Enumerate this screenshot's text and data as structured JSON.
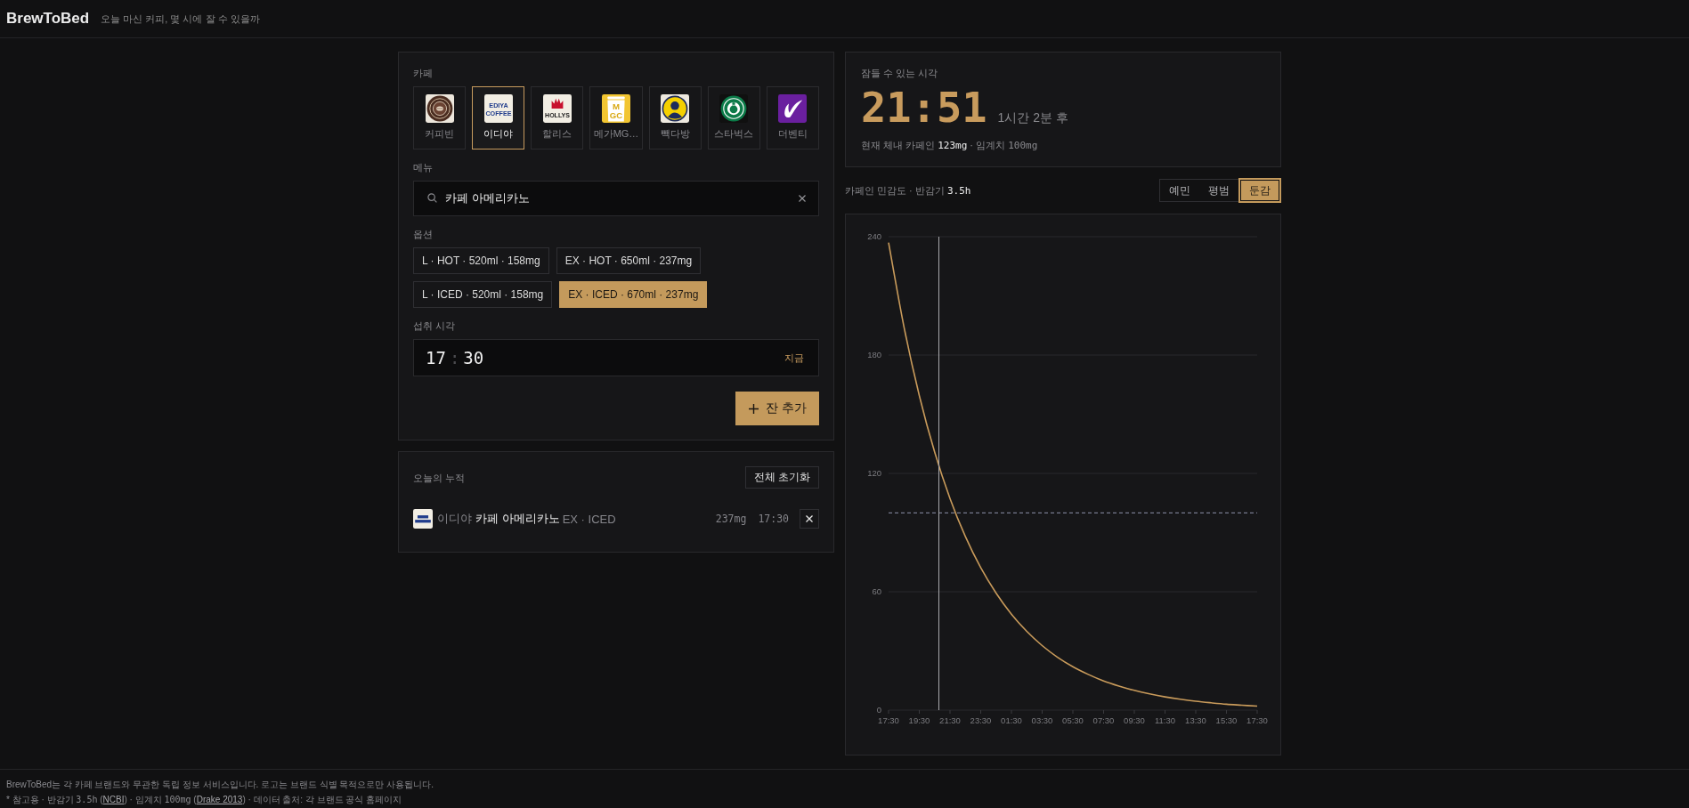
{
  "header": {
    "title": "BrewToBed",
    "subtitle": "오늘 마신 커피, 몇 시에 잘 수 있을까"
  },
  "order_panel": {
    "cafe_label": "카페",
    "cafes": [
      {
        "name": "커피빈",
        "kind": "emblem",
        "selected": false
      },
      {
        "name": "이디야",
        "kind": "wordmark",
        "logo_text": [
          "EDIYA",
          "COFFEE"
        ],
        "selected": true
      },
      {
        "name": "할리스",
        "kind": "crown",
        "logo_text": [
          "HOLLYS"
        ],
        "selected": false
      },
      {
        "name": "메가MG…",
        "kind": "cup",
        "logo_text": [
          "M",
          "GC"
        ],
        "selected": false
      },
      {
        "name": "빽다방",
        "kind": "portrait",
        "selected": false
      },
      {
        "name": "스타벅스",
        "kind": "seal",
        "selected": false
      },
      {
        "name": "더벤티",
        "kind": "swoosh",
        "selected": false
      }
    ],
    "menu_label": "메뉴",
    "menu_search": {
      "value": "카페 아메리카노"
    },
    "option_label": "옵션",
    "options": [
      {
        "label": "L · HOT · 520ml · 158mg",
        "selected": false
      },
      {
        "label": "EX · HOT · 650ml · 237mg",
        "selected": false
      },
      {
        "label": "L · ICED · 520ml · 158mg",
        "selected": false
      },
      {
        "label": "EX · ICED · 670ml · 237mg",
        "selected": true
      }
    ],
    "time_label": "섭취 시각",
    "time_input": {
      "hour": "17",
      "separator": ":",
      "minute": "30",
      "now_button": "지금"
    },
    "add_button": "잔 추가"
  },
  "today_panel": {
    "title": "오늘의 누적",
    "reset_button": "전체 초기화",
    "entries": [
      {
        "kind": "wordmark",
        "brand": "이디야",
        "menu": "카페 아메리카노",
        "option": "EX · ICED",
        "amount": "237mg",
        "time": "17:30"
      }
    ]
  },
  "sleep_card": {
    "label": "잠들 수 있는 시각",
    "time": "21:51",
    "relative": "1시간 2분 후",
    "detail": [
      {
        "kind": "text",
        "text": "현재 체내 카페인 "
      },
      {
        "kind": "value",
        "text": "123mg"
      },
      {
        "kind": "text",
        "text": " · 임계치 "
      },
      {
        "kind": "mono",
        "text": "100mg"
      }
    ]
  },
  "sensitivity": {
    "label": [
      {
        "kind": "text",
        "text": "카페인 민감도 · 반감기 "
      },
      {
        "kind": "value",
        "text": "3.5h"
      }
    ],
    "choices": [
      {
        "label": "예민",
        "selected": false
      },
      {
        "label": "평범",
        "selected": false
      },
      {
        "label": "둔감",
        "selected": true
      }
    ]
  },
  "caffeine_chart": {
    "chart_data": {
      "type": "line",
      "categories": [
        "17:30",
        null,
        "19:30",
        null,
        "21:30",
        null,
        "23:30",
        null,
        "01:30",
        null,
        "03:30",
        null,
        "05:30",
        null,
        "07:30",
        null,
        "09:30",
        null,
        "11:30",
        null,
        "13:30",
        null,
        "15:30",
        null,
        "17:30"
      ],
      "series": [
        {
          "color": "#c99b5b",
          "values": [
            237,
            194.4,
            159.5,
            130.8,
            107.3,
            88.0,
            72.2,
            59.3,
            48.6,
            39.9,
            32.7,
            26.8,
            22.0,
            18.1,
            14.8,
            12.2,
            10.0,
            8.2,
            6.7,
            5.5,
            4.5,
            3.7,
            3.0,
            2.5,
            2.0
          ]
        }
      ],
      "ylim": [
        0,
        240
      ],
      "yticks": [
        0,
        60,
        120,
        180,
        240
      ],
      "grid": true,
      "ref_lines": [
        {
          "axis": "y",
          "value": 100
        }
      ]
    }
  },
  "footer": {
    "notice": "BrewToBed는 각 카페 브랜드와 무관한 독립 정보 서비스입니다. 로고는 브랜드 식별 목적으로만 사용됩니다.",
    "note": [
      {
        "kind": "text",
        "text": "* 참고용 · 반감기 "
      },
      {
        "kind": "mono",
        "text": "3.5h"
      },
      {
        "kind": "text",
        "text": " ("
      },
      {
        "kind": "link",
        "text": "NCBI"
      },
      {
        "kind": "text",
        "text": ") · 임계치 "
      },
      {
        "kind": "mono",
        "text": "100mg"
      },
      {
        "kind": "text",
        "text": " ("
      },
      {
        "kind": "link",
        "text": "Drake 2013"
      },
      {
        "kind": "text",
        "text": ") · 데이터 출처: 각 브랜드 공식 홈페이지"
      }
    ]
  }
}
